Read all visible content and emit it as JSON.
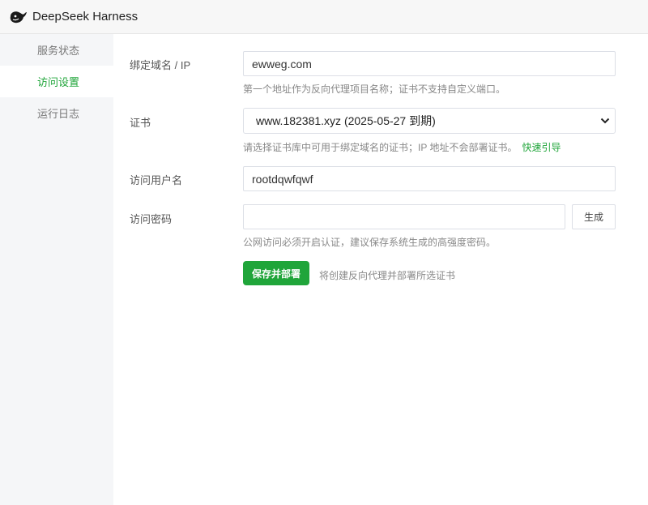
{
  "window": {
    "title": "DeepSeek Harness",
    "logo_icon": "whale-icon"
  },
  "sidebar": {
    "items": [
      {
        "label": "服务状态",
        "active": false
      },
      {
        "label": "访问设置",
        "active": true
      },
      {
        "label": "运行日志",
        "active": false
      }
    ]
  },
  "form": {
    "domain": {
      "label": "绑定域名 / IP",
      "value": "ewweg.com",
      "hint": "第一个地址作为反向代理项目名称；证书不支持自定义端口。"
    },
    "cert": {
      "label": "证书",
      "selected": "www.182381.xyz (2025-05-27 到期)",
      "hint": "请选择证书库中可用于绑定域名的证书；IP 地址不会部署证书。",
      "hint_link": "快速引导"
    },
    "username": {
      "label": "访问用户名",
      "value": "rootdqwfqwf"
    },
    "password": {
      "label": "访问密码",
      "value": "",
      "generate_label": "生成",
      "hint": "公网访问必须开启认证，建议保存系统生成的高强度密码。"
    },
    "submit": {
      "label": "保存并部署",
      "note": "将创建反向代理并部署所选证书"
    }
  },
  "colors": {
    "accent": "#20a53a",
    "sidebar_bg": "#f5f6f8",
    "titlebar_bg": "#f7f7f7"
  }
}
